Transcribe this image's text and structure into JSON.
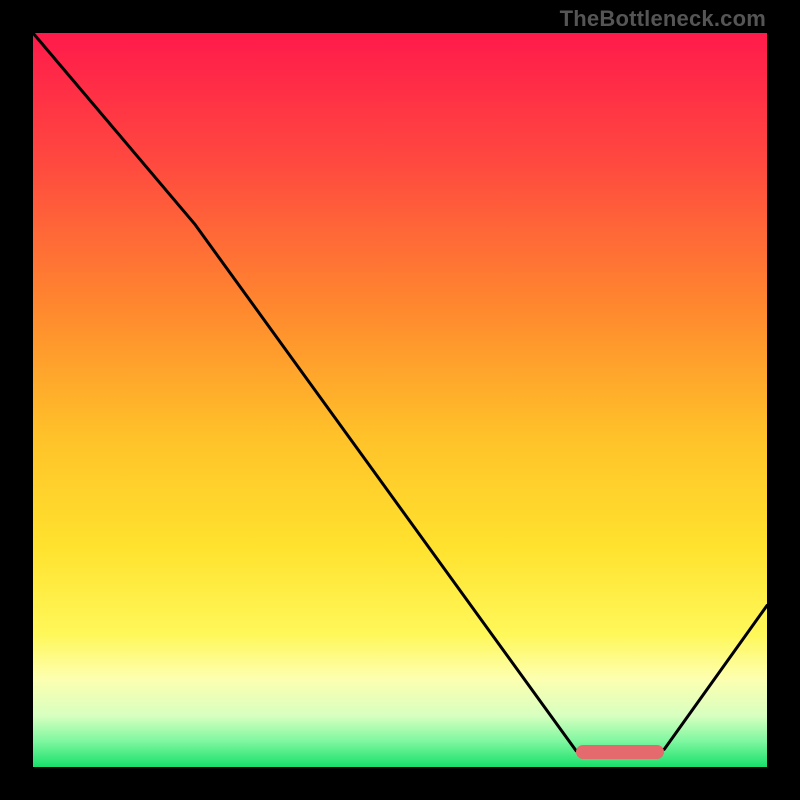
{
  "watermark": "TheBottleneck.com",
  "chart_data": {
    "type": "line",
    "title": "",
    "xlabel": "",
    "ylabel": "",
    "xlim": [
      0,
      100
    ],
    "ylim": [
      0,
      100
    ],
    "gradient_stops": [
      {
        "pct": 0,
        "color": "#ff1a4b"
      },
      {
        "pct": 18,
        "color": "#ff4a3f"
      },
      {
        "pct": 38,
        "color": "#ff8a2e"
      },
      {
        "pct": 55,
        "color": "#ffc229"
      },
      {
        "pct": 70,
        "color": "#ffe22e"
      },
      {
        "pct": 82,
        "color": "#fff85a"
      },
      {
        "pct": 88,
        "color": "#fdffb0"
      },
      {
        "pct": 93,
        "color": "#d8ffc0"
      },
      {
        "pct": 96.5,
        "color": "#7ef7a0"
      },
      {
        "pct": 100,
        "color": "#18e06a"
      }
    ],
    "series": [
      {
        "name": "curve",
        "x": [
          0,
          22,
          74,
          78,
          86,
          100
        ],
        "y": [
          100,
          74,
          2.2,
          1.6,
          2.4,
          22
        ]
      }
    ],
    "optimum_marker": {
      "x_start": 74,
      "x_end": 86,
      "y": 2.1
    }
  }
}
